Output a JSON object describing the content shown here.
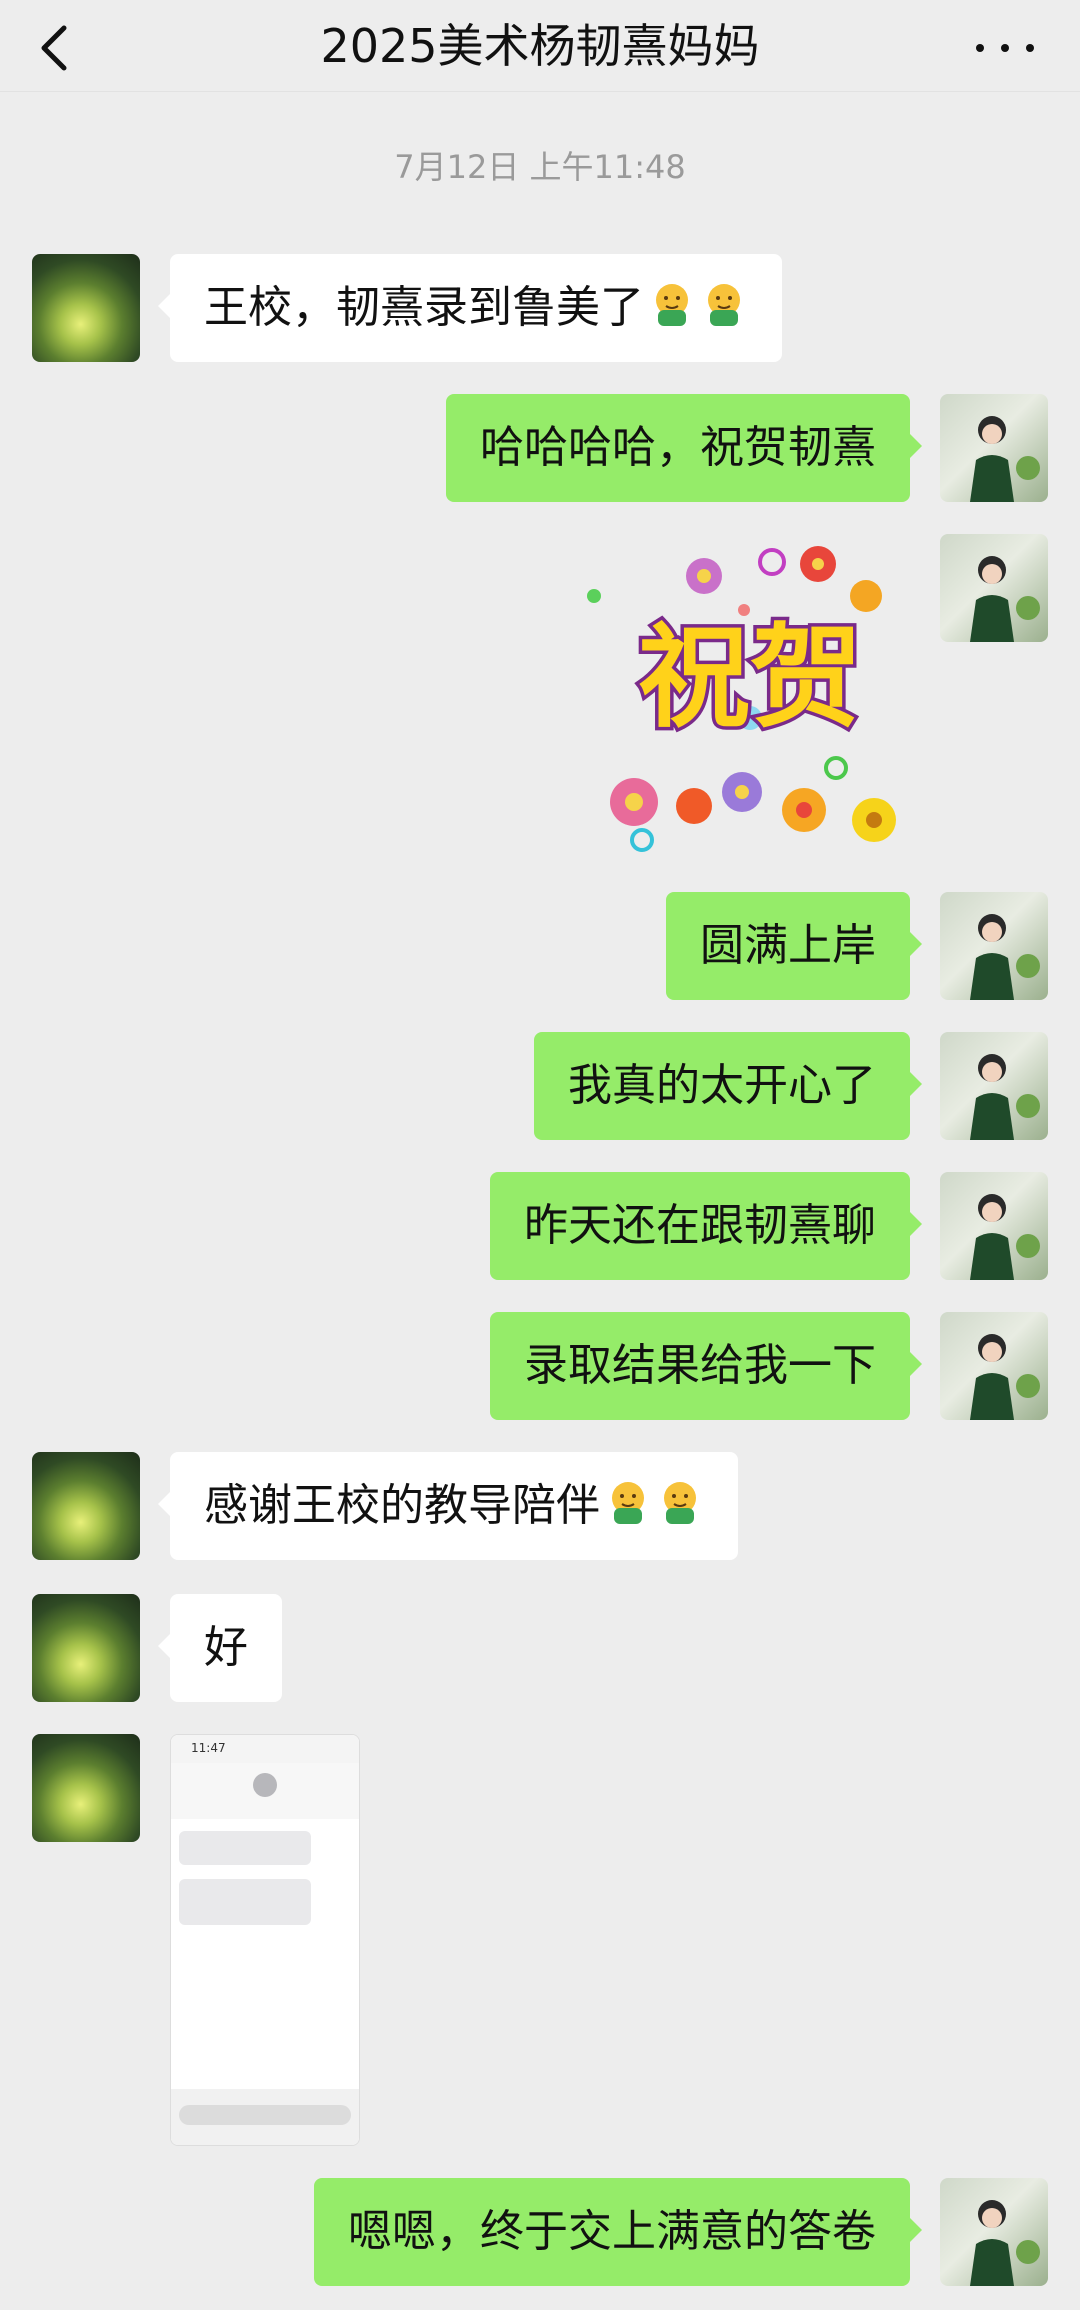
{
  "header": {
    "title": "2025美术杨韧熹妈妈"
  },
  "timestamp": "7月12日 上午11:48",
  "messages": [
    {
      "side": "left",
      "text": "王校，韧熹录到鲁美了",
      "emoji_count": 2
    },
    {
      "side": "right",
      "text": "哈哈哈哈，祝贺韧熹"
    },
    {
      "side": "right",
      "type": "sticker",
      "sticker_text": "祝贺"
    },
    {
      "side": "right",
      "text": "圆满上岸"
    },
    {
      "side": "right",
      "text": "我真的太开心了"
    },
    {
      "side": "right",
      "text": "昨天还在跟韧熹聊"
    },
    {
      "side": "right",
      "text": "录取结果给我一下"
    },
    {
      "side": "left",
      "text": "感谢王校的教导陪伴",
      "emoji_count": 2
    },
    {
      "side": "left",
      "text": "好"
    },
    {
      "side": "left",
      "type": "image",
      "image_time": "11:47"
    },
    {
      "side": "right",
      "text": "嗯嗯，终于交上满意的答卷"
    }
  ],
  "colors": {
    "background": "#ededed",
    "sent_bubble": "#95ec69",
    "received_bubble": "#ffffff"
  }
}
